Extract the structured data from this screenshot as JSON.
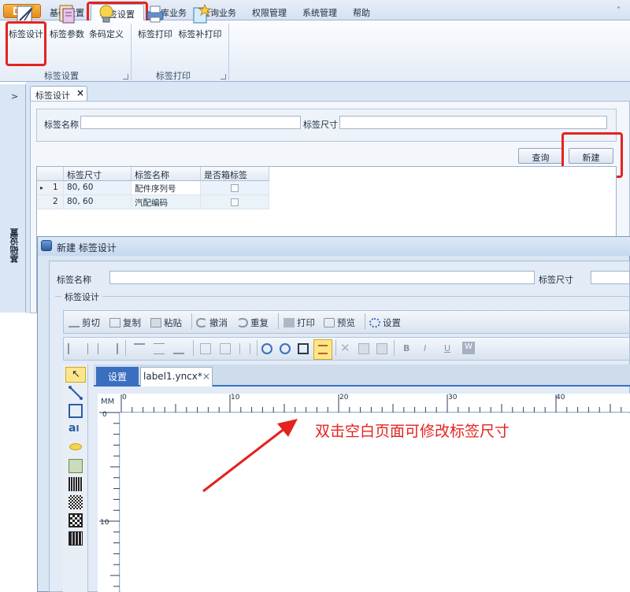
{
  "ribbon": {
    "tabs": [
      "基础设置",
      "标签设置",
      "仓库业务",
      "查询业务",
      "权限管理",
      "系统管理",
      "帮助"
    ],
    "groups": [
      {
        "label": "标签设置",
        "buttons": [
          "标签设计",
          "标签参数",
          "条码定义"
        ]
      },
      {
        "label": "标签打印",
        "buttons": [
          "标签打印",
          "标签补打印"
        ]
      }
    ]
  },
  "sidepanel": {
    "label": "基础设置",
    "collapse": ">"
  },
  "doc": {
    "tab_label": "标签设计",
    "close": "×",
    "name_label": "标签名称",
    "size_label": "标签尺寸",
    "query_button": "查询",
    "new_button": "新建",
    "grid": {
      "headers": [
        "标签尺寸",
        "标签名称",
        "是否箱标签"
      ],
      "rows": [
        {
          "num": "1",
          "size": "80, 60",
          "name": "配件序列号",
          "marker": "▸"
        },
        {
          "num": "2",
          "size": "80, 60",
          "name": "汽配编码",
          "marker": ""
        }
      ]
    }
  },
  "dialog": {
    "title": "新建 标签设计",
    "name_label": "标签名称",
    "size_label": "标签尺寸",
    "section_label": "标签设计",
    "toolbar": [
      "剪切",
      "复制",
      "粘贴",
      "撤消",
      "重复",
      "打印",
      "预览",
      "设置"
    ],
    "format_buttons": [
      "B",
      "I",
      "U",
      "W"
    ],
    "canvas_tabs": [
      "设置",
      "label1.yncx*"
    ],
    "canvas_tab_close": "×",
    "ruler_unit": "MM",
    "ruler_h": [
      "0",
      "10",
      "20",
      "30",
      "40"
    ],
    "ruler_v": [
      "0",
      "10"
    ]
  },
  "annotation": "双击空白页面可修改标签尺寸",
  "colors": {
    "highlight": "#e3231f",
    "accent": "#3a6fc0"
  }
}
